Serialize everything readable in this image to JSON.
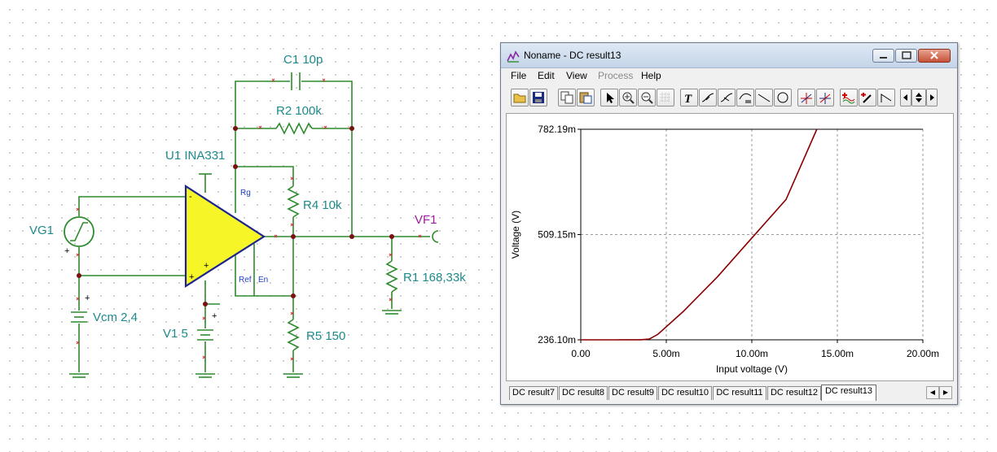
{
  "schematic": {
    "labels": {
      "c1": "C1 10p",
      "r2": "R2 100k",
      "u1": "U1 INA331",
      "r4": "R4 10k",
      "vf1": "VF1",
      "vg1": "VG1",
      "r1": "R1 168,33k",
      "vcm": "Vcm 2,4",
      "v1": "V1 5",
      "r5": "R5 150",
      "pin_rg": "Rg",
      "pin_ref": "Ref",
      "pin_en": "En",
      "plus": "+",
      "minus": "-"
    }
  },
  "window": {
    "title": "Noname - DC result13",
    "menu": [
      {
        "label": "File",
        "disabled": false
      },
      {
        "label": "Edit",
        "disabled": false
      },
      {
        "label": "View",
        "disabled": false
      },
      {
        "label": "Process",
        "disabled": true
      },
      {
        "label": "Help",
        "disabled": false
      }
    ],
    "toolbar_icons": [
      "open-folder-icon",
      "save-icon",
      "copy-icon",
      "paste-icon",
      "select-arrow-icon",
      "zoom-in-icon",
      "zoom-out-icon",
      "grid-icon",
      "text-tool-icon",
      "curve-tool-a-icon",
      "curve-tool-b-icon",
      "curve-tool-c-icon",
      "line-tool-icon",
      "circle-tool-icon",
      "cursor-a-icon",
      "cursor-b-icon",
      "add-trace-icon",
      "probe-icon",
      "marker-icon",
      "scroll-left-icon",
      "scroll-updown-icon",
      "scroll-right-icon"
    ],
    "tabs": [
      "DC result7",
      "DC result8",
      "DC result9",
      "DC result10",
      "DC result11",
      "DC result12",
      "DC result13"
    ],
    "active_tab": "DC result13"
  },
  "chart_data": {
    "type": "line",
    "xlabel": "Input voltage (V)",
    "ylabel": "Voltage (V)",
    "x_ticks": [
      "0.00",
      "5.00m",
      "10.00m",
      "15.00m",
      "20.00m"
    ],
    "y_ticks": [
      "236.10m",
      "509.15m",
      "782.19m"
    ],
    "xlim": [
      0,
      0.02
    ],
    "ylim": [
      0.2361,
      0.78219
    ],
    "grid": true,
    "series": [
      {
        "color": "#8b0000",
        "x": [
          0,
          0.002,
          0.0035,
          0.004,
          0.0045,
          0.006,
          0.008,
          0.01,
          0.012,
          0.0138
        ],
        "y": [
          0.2361,
          0.2361,
          0.2364,
          0.238,
          0.25,
          0.31,
          0.4,
          0.5,
          0.6,
          0.78219
        ]
      }
    ]
  }
}
